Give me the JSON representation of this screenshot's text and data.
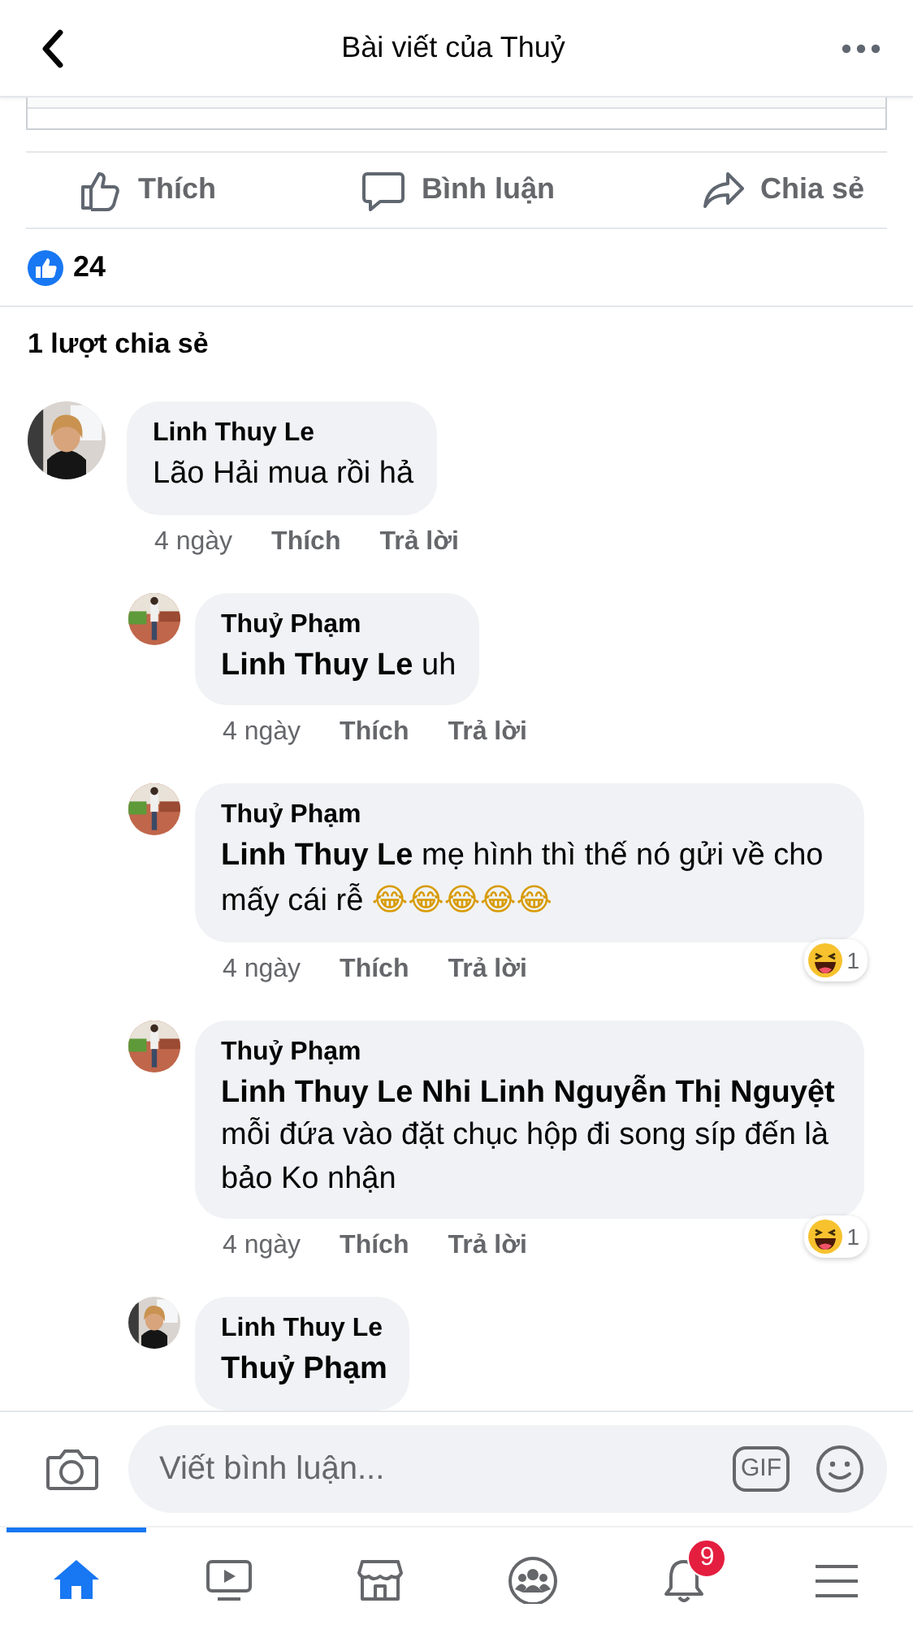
{
  "header": {
    "title": "Bài viết của Thuỷ"
  },
  "actions": [
    {
      "kind": "like",
      "label": "Thích"
    },
    {
      "kind": "comment",
      "label": "Bình luận"
    },
    {
      "kind": "share",
      "label": "Chia sẻ"
    }
  ],
  "reactions": {
    "count": "24"
  },
  "shares": "1 lượt chia sẻ",
  "comments": [
    {
      "author": "Linh Thuy Le",
      "text": "Lão Hải mua rồi hả",
      "time": "4 ngày",
      "like": "Thích",
      "reply": "Trả lời",
      "children": [
        {
          "author": "Thuỷ Phạm",
          "text": "**Linh Thuy Le** uh",
          "time": "4 ngày",
          "like": "Thích",
          "reply": "Trả lời"
        },
        {
          "author": "Thuỷ Phạm",
          "text": "**Linh Thuy Le** mẹ hình thì thế nó gửi về cho mấy cái rễ 😂😂😂😂😂",
          "time": "4 ngày",
          "like": "Thích",
          "reply": "Trả lời",
          "reaction": {
            "kind": "haha",
            "count": "1"
          }
        },
        {
          "author": "Thuỷ Phạm",
          "text": "**Linh Thuy Le Nhi Linh Nguyễn Thị Nguyệt** mỗi đứa vào đặt chục hộp đi song síp đến là bảo Ko nhận",
          "time": "4 ngày",
          "like": "Thích",
          "reply": "Trả lời",
          "reaction": {
            "kind": "haha",
            "count": "1"
          }
        },
        {
          "author": "Linh Thuy Le",
          "text": "**Thuỷ Phạm**"
        }
      ]
    }
  ],
  "composer": {
    "placeholder": "Viết bình luận...",
    "gif_label": "GIF"
  },
  "nav": [
    {
      "kind": "home",
      "selected": true
    },
    {
      "kind": "video",
      "selected": false
    },
    {
      "kind": "marketplace",
      "selected": false
    },
    {
      "kind": "groups",
      "selected": false
    },
    {
      "kind": "notifications",
      "selected": false,
      "badge": "9"
    },
    {
      "kind": "menu",
      "selected": false
    }
  ]
}
